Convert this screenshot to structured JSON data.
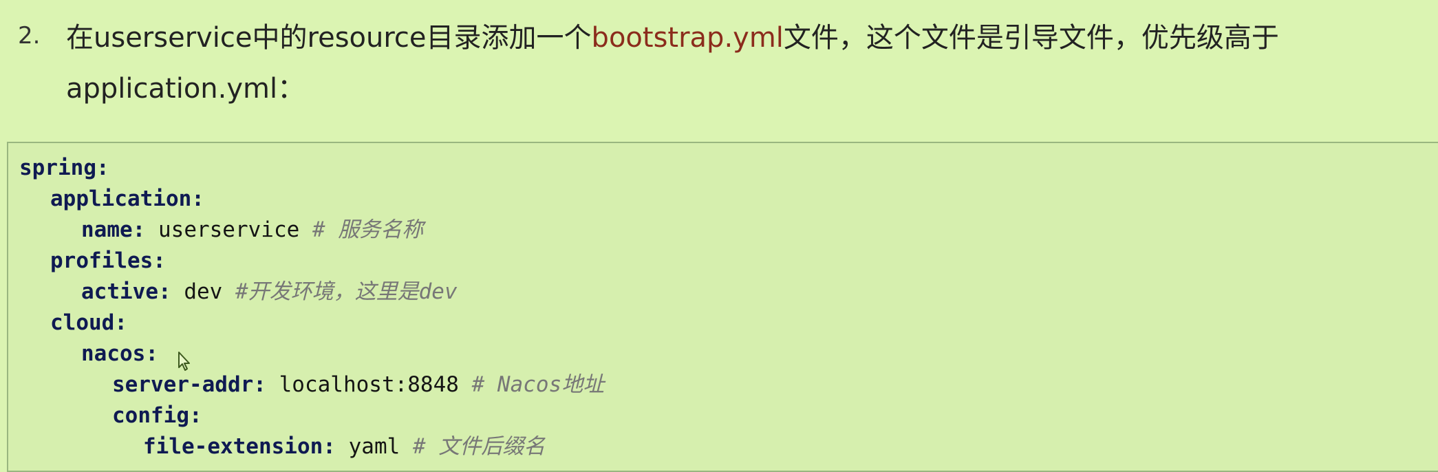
{
  "step": {
    "number": "2.",
    "text_before": "在userservice中的resource目录添加一个",
    "file_name": "bootstrap.yml",
    "text_after": "文件，这个文件是引导文件，优先级高于",
    "second_line": "application.yml："
  },
  "code": [
    {
      "key": "spring:",
      "value": "",
      "comment": ""
    },
    {
      "key": "application:",
      "value": "",
      "comment": ""
    },
    {
      "key": "name:",
      "value": " userservice ",
      "comment": "# 服务名称"
    },
    {
      "key": "profiles:",
      "value": "",
      "comment": ""
    },
    {
      "key": "active:",
      "value": " dev ",
      "comment": "#开发环境，这里是dev"
    },
    {
      "key": "cloud:",
      "value": "",
      "comment": ""
    },
    {
      "key": "nacos:",
      "value": "",
      "comment": ""
    },
    {
      "key": "server-addr:",
      "value": " localhost:8848 ",
      "comment": "# Nacos地址"
    },
    {
      "key": "config:",
      "value": "",
      "comment": ""
    },
    {
      "key": "file-extension:",
      "value": " yaml ",
      "comment": "# 文件后缀名"
    }
  ]
}
